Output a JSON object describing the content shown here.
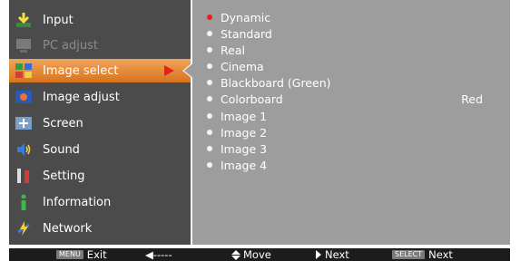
{
  "menu": {
    "items": [
      {
        "label": "Input",
        "icon": "input-icon",
        "state": "normal"
      },
      {
        "label": "PC adjust",
        "icon": "pc-adjust-icon",
        "state": "disabled"
      },
      {
        "label": "Image select",
        "icon": "image-select-icon",
        "state": "selected"
      },
      {
        "label": "Image adjust",
        "icon": "image-adjust-icon",
        "state": "normal"
      },
      {
        "label": "Screen",
        "icon": "screen-icon",
        "state": "normal"
      },
      {
        "label": "Sound",
        "icon": "sound-icon",
        "state": "normal"
      },
      {
        "label": "Setting",
        "icon": "setting-icon",
        "state": "normal"
      },
      {
        "label": "Information",
        "icon": "information-icon",
        "state": "normal"
      },
      {
        "label": "Network",
        "icon": "network-icon",
        "state": "normal"
      }
    ]
  },
  "options": {
    "items": [
      {
        "label": "Dynamic",
        "active": true,
        "value": ""
      },
      {
        "label": "Standard",
        "active": false,
        "value": ""
      },
      {
        "label": "Real",
        "active": false,
        "value": ""
      },
      {
        "label": "Cinema",
        "active": false,
        "value": ""
      },
      {
        "label": "Blackboard (Green)",
        "active": false,
        "value": ""
      },
      {
        "label": "Colorboard",
        "active": false,
        "value": "Red"
      },
      {
        "label": "Image 1",
        "active": false,
        "value": ""
      },
      {
        "label": "Image 2",
        "active": false,
        "value": ""
      },
      {
        "label": "Image 3",
        "active": false,
        "value": ""
      },
      {
        "label": "Image 4",
        "active": false,
        "value": ""
      }
    ]
  },
  "footer": {
    "exit_key": "MENU",
    "exit_label": "Exit",
    "back_label": "◀-----",
    "move_label": "Move",
    "next_label": "Next",
    "select_key": "SELECT",
    "select_next_label": "Next"
  },
  "colors": {
    "menu_bg": "#4b4b4b",
    "panel_bg": "#9d9d9d",
    "highlight": "#e07d28",
    "active_dot": "#e8201c"
  }
}
